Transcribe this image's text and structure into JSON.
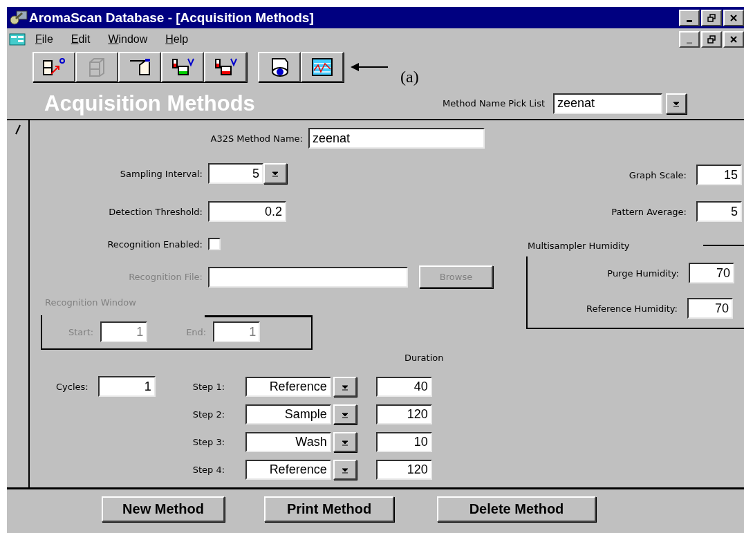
{
  "window": {
    "title": "AromaScan Database - [Acquisition Methods]",
    "controls": [
      {
        "kind": "minimize",
        "disabled": false
      },
      {
        "kind": "restore",
        "disabled": false
      },
      {
        "kind": "close",
        "disabled": false
      }
    ]
  },
  "menu_bar": {
    "items": [
      {
        "label": "File"
      },
      {
        "label": "Edit"
      },
      {
        "label": "Window"
      },
      {
        "label": "Help"
      }
    ],
    "controls": [
      {
        "kind": "minimize",
        "disabled": true
      },
      {
        "kind": "restore",
        "disabled": false
      },
      {
        "kind": "close",
        "disabled": false
      }
    ]
  },
  "toolbar": {
    "groups": [
      [
        {
          "kind": "help",
          "disabled": false
        },
        {
          "kind": "cabinet",
          "disabled": true
        },
        {
          "kind": "folder",
          "disabled": false
        },
        {
          "kind": "vials_a",
          "disabled": false
        },
        {
          "kind": "vials_s",
          "disabled": false
        }
      ],
      [
        {
          "kind": "view",
          "disabled": false
        },
        {
          "kind": "graph",
          "disabled": false
        }
      ]
    ]
  },
  "annotation": {
    "label": "(a)"
  },
  "header": {
    "title": "Acquisition Methods",
    "pick_list": {
      "label": "Method Name Pick List",
      "value": "zeenat"
    }
  },
  "form": {
    "method_name": {
      "label": "A32S Method Name:",
      "value": "zeenat"
    },
    "sampling_interval": {
      "label": "Sampling Interval:",
      "value": "5"
    },
    "detection_threshold": {
      "label": "Detection Threshold:",
      "value": "0.2"
    },
    "recognition_enabled": {
      "label": "Recognition Enabled:",
      "checked": false
    },
    "recognition_file": {
      "label": "Recognition File:",
      "disabled": true,
      "browse": "Browse"
    },
    "recognition_window": {
      "title": "Recognition Window",
      "disabled": true,
      "start": {
        "label": "Start:",
        "value": "1"
      },
      "end": {
        "label": "End:",
        "value": "1"
      }
    },
    "duration_heading": "Duration",
    "cycles": {
      "label": "Cycles:",
      "value": "1"
    },
    "steps": [
      {
        "label": "Step 1:",
        "value": "Reference",
        "duration": "40"
      },
      {
        "label": "Step 2:",
        "value": "Sample",
        "duration": "120"
      },
      {
        "label": "Step 3:",
        "value": "Wash",
        "duration": "10"
      },
      {
        "label": "Step 4:",
        "value": "Reference",
        "duration": "120"
      }
    ],
    "graph_scale": {
      "label": "Graph Scale:",
      "value": "15"
    },
    "pattern_average": {
      "label": "Pattern Average:",
      "value": "5"
    },
    "humidity": {
      "title": "Multisampler Humidity",
      "purge": {
        "label": "Purge Humidity:",
        "value": "70"
      },
      "reference": {
        "label": "Reference Humidity:",
        "value": "70"
      }
    }
  },
  "buttons": [
    {
      "label": "New Method"
    },
    {
      "label": "Print Method"
    },
    {
      "label": "Delete Method"
    }
  ]
}
